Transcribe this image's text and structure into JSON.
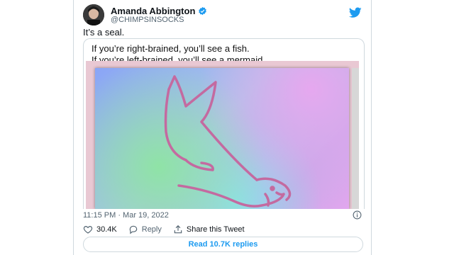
{
  "author": {
    "name": "Amanda Abbington",
    "handle": "@CHIMPSINSOCKS"
  },
  "tweet": {
    "text": "It’s a seal."
  },
  "media": {
    "caption_line1": "If you’re right-brained, you’ll see a fish.",
    "caption_line2": "If you’re left-brained, you’ll see a mermaid."
  },
  "meta": {
    "timestamp": "11:15 PM · Mar 19, 2022"
  },
  "actions": {
    "likes": "30.4K",
    "reply": "Reply",
    "share": "Share this Tweet"
  },
  "replies_button": "Read 10.7K replies",
  "colors": {
    "twitter_blue": "#1d9bf0",
    "like_red": "#f91880",
    "line_drawing": "#c46aa0"
  },
  "icons": [
    "verified-badge-icon",
    "twitter-bird-icon",
    "info-icon",
    "heart-icon",
    "reply-icon",
    "share-icon"
  ]
}
